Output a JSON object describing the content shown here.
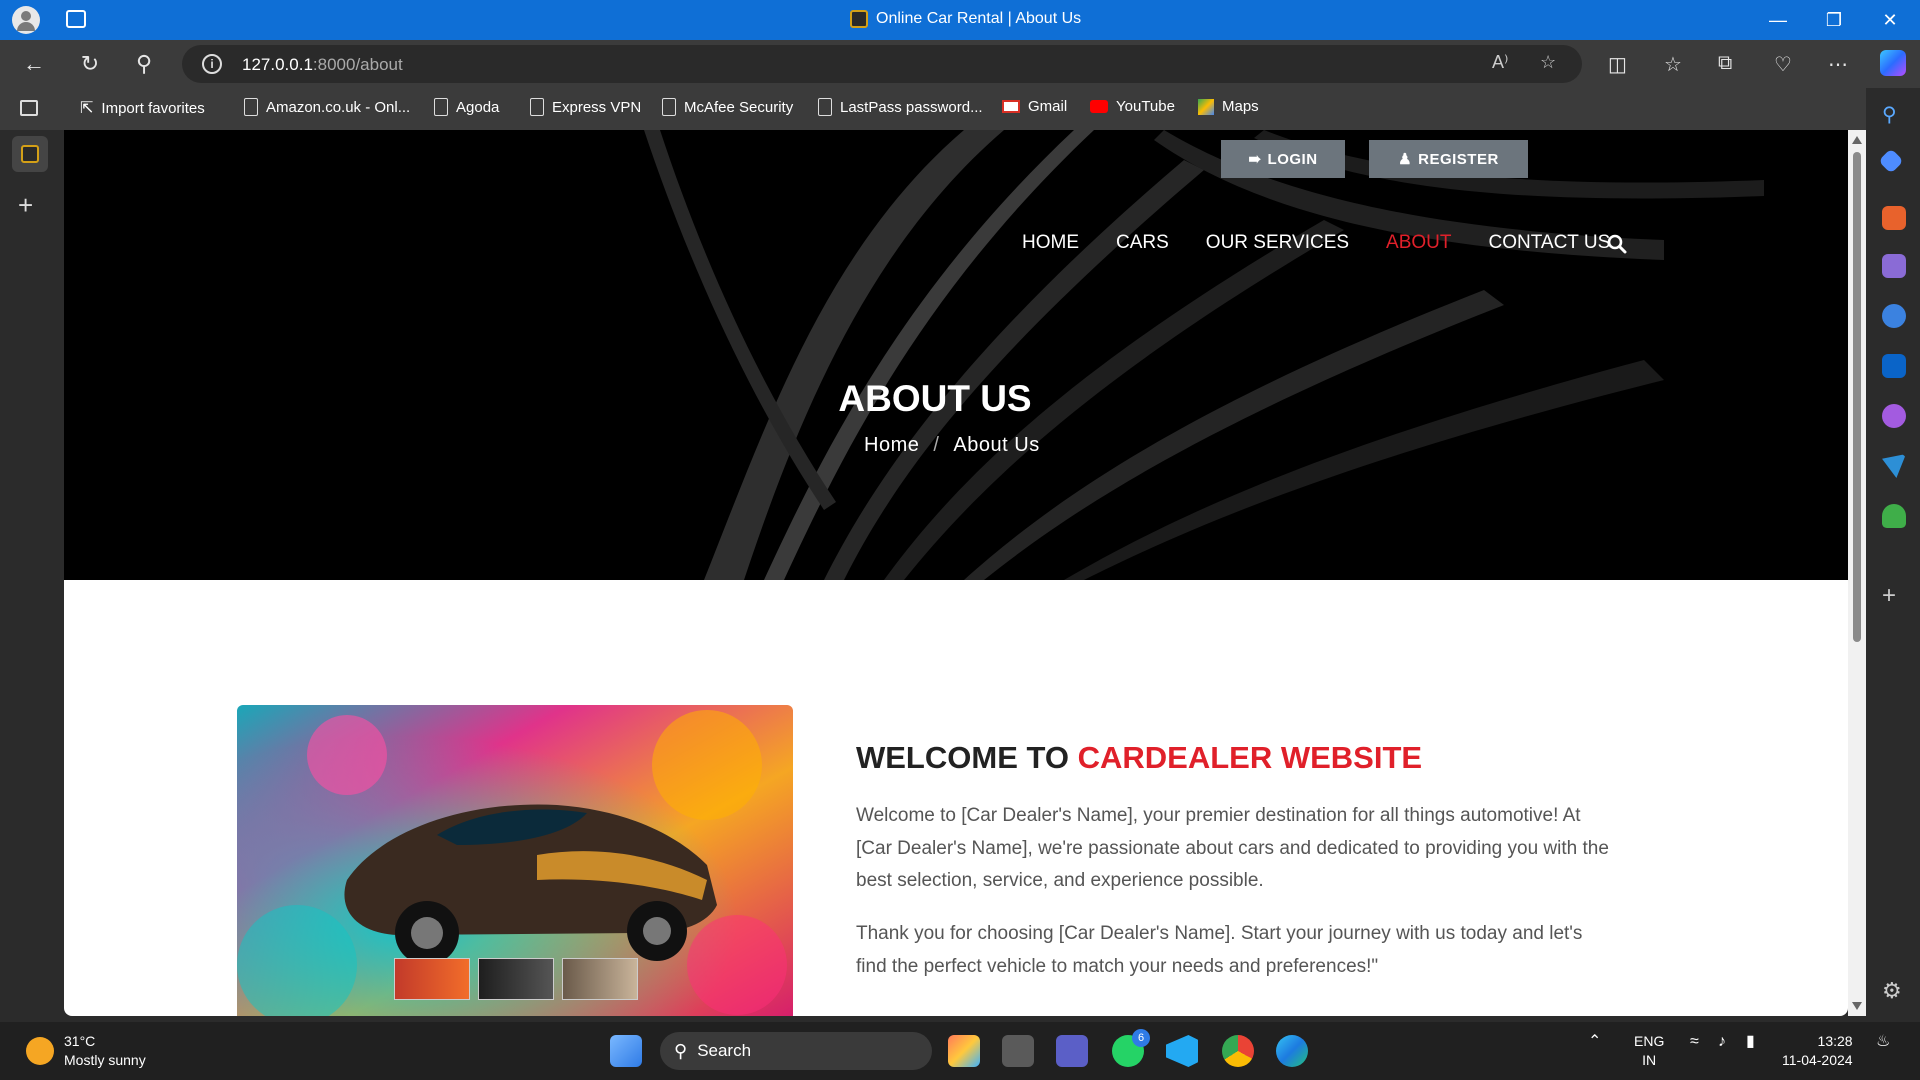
{
  "browser": {
    "window_title": "Online Car Rental | About Us",
    "url_host": "127.0.0.1",
    "url_path": ":8000/about",
    "read_aloud": "A⁾",
    "bookmarks": [
      "Import favorites",
      "Amazon.co.uk - Onl...",
      "Agoda",
      "Express VPN",
      "McAfee Security",
      "LastPass password...",
      "Gmail",
      "YouTube",
      "Maps"
    ]
  },
  "site": {
    "login_label": "LOGIN",
    "register_label": "REGISTER",
    "nav": [
      "HOME",
      "CARS",
      "OUR SERVICES",
      "ABOUT",
      "CONTACT US"
    ],
    "active_nav": "ABOUT",
    "hero_title": "ABOUT US",
    "breadcrumb": {
      "home": "Home",
      "separator": "/",
      "current": "About Us"
    },
    "welcome_prefix": "WELCOME TO",
    "welcome_highlight": "CARDEALER WEBSITE",
    "para1": "Welcome to [Car Dealer's Name], your premier destination for all things automotive! At [Car Dealer's Name], we're passionate about cars and dedicated to providing you with the best selection, service, and experience possible.",
    "para2": "Thank you for choosing [Car Dealer's Name]. Start your journey with us today and let's find the perfect vehicle to match your needs and preferences!\"",
    "accent_color": "#e0202a"
  },
  "taskbar": {
    "temp": "31°C",
    "weather": "Mostly sunny",
    "search": "Search",
    "whatsapp_badge": "6",
    "lang1": "ENG",
    "lang2": "IN",
    "time": "13:28",
    "date": "11-04-2024"
  }
}
